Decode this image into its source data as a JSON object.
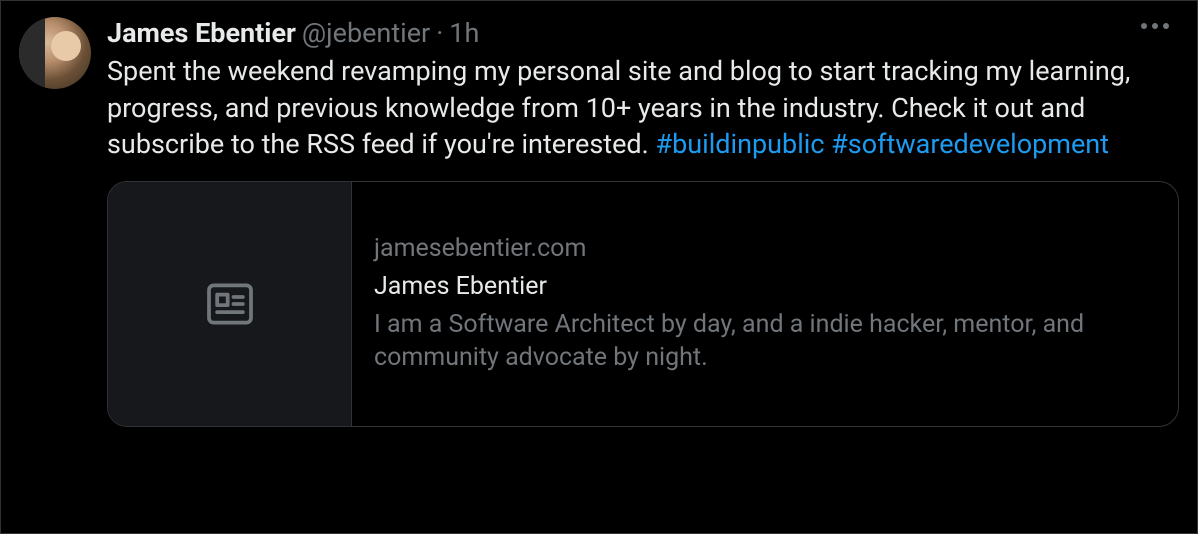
{
  "tweet": {
    "author": {
      "display_name": "James Ebentier",
      "handle": "@jebentier",
      "separator": "·",
      "time": "1h"
    },
    "text": "Spent the weekend revamping my personal site and blog to start tracking my learning, progress, and previous knowledge from 10+ years in the industry. Check it out and subscribe to the RSS feed if you're interested.",
    "hashtags": [
      "#buildinpublic",
      "#softwaredevelopment"
    ],
    "card": {
      "domain": "jamesebentier.com",
      "title": "James Ebentier",
      "description": "I am a Software Architect by day, and a indie hacker, mentor, and community advocate by night."
    }
  }
}
